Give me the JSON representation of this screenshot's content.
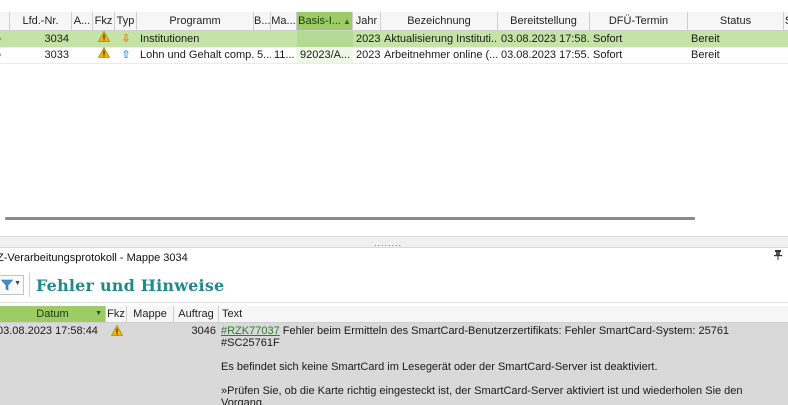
{
  "top_grid": {
    "columns": [
      "Lfd.-Nr.",
      "A...",
      "Fkz",
      "Typ",
      "Programm",
      "B...",
      "Ma...",
      "Basis-I...",
      "Jahr",
      "Bezeichnung",
      "Bereitstellung",
      "DFÜ-Termin",
      "Status",
      "S"
    ],
    "sorted_column": "Basis-I...",
    "rows": [
      {
        "lfd_nr": "3034",
        "fkz": "warning",
        "typ": "download",
        "programm": "Institutionen",
        "b": "",
        "ma": "",
        "basis": "",
        "jahr": "2023",
        "bezeichnung": "Aktualisierung Instituti...",
        "bereitstellung": "03.08.2023  17:58...",
        "dfu_termin": "Sofort",
        "status": "Bereit",
        "selected": true
      },
      {
        "lfd_nr": "3033",
        "fkz": "warning",
        "typ": "upload",
        "programm": "Lohn und Gehalt comp...",
        "b": "5...",
        "ma": "11...",
        "basis": "92023/A...",
        "jahr": "2023",
        "bezeichnung": "Arbeitnehmer online (...",
        "bereitstellung": "03.08.2023  17:55...",
        "dfu_termin": "Sofort",
        "status": "Bereit",
        "selected": false
      }
    ]
  },
  "panel": {
    "caption": "Z-Verarbeitungsprotokoll - Mappe 3034",
    "section_title": "Fehler und Hinweise"
  },
  "bottom_grid": {
    "columns": [
      "Datum",
      "Fkz",
      "Mappe",
      "Auftrag",
      "Text"
    ],
    "rows": [
      {
        "datum": "03.08.2023 17:58:44",
        "fkz": "warning",
        "mappe": "",
        "auftrag": "3046",
        "link": "#RZK77037",
        "text_line1": "Fehler beim Ermitteln des SmartCard-Benutzerzertifikats: Fehler SmartCard-System: 25761",
        "text_line2": "#SC25761F",
        "text_line3": "Es befindet sich keine SmartCard im Lesegerät oder der SmartCard-Server ist deaktiviert.",
        "text_line4": "»Prüfen Sie, ob die Karte richtig eingesteckt ist, der SmartCard-Server aktiviert ist und wiederholen Sie den Vorgang."
      }
    ]
  },
  "colors": {
    "selected_row": "#c5e3a6",
    "sorted_header": "#9ccc65",
    "title_teal": "#1f8a8a",
    "warning": "#f2b705",
    "link": "#2e7d32"
  }
}
